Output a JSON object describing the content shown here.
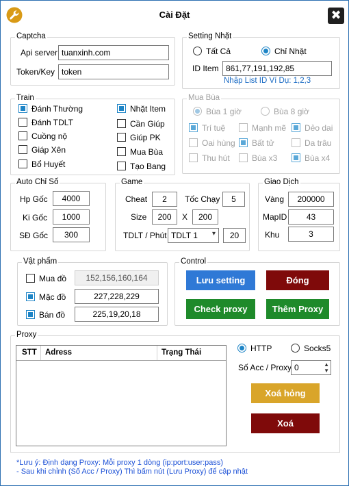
{
  "window": {
    "title": "Cài Đặt",
    "close_glyph": "✖"
  },
  "colors": {
    "accent": "#1d84c6",
    "btn_blue": "#2f79d6",
    "btn_red": "#7f0a0a",
    "btn_green": "#1e8a2a",
    "btn_gold": "#d9a52a",
    "link": "#1a6bc4"
  },
  "captcha": {
    "legend": "Captcha",
    "api_label": "Api server",
    "api_value": "tuanxinh.com",
    "token_label": "Token/Key",
    "token_value": "token"
  },
  "setting_nhat": {
    "legend": "Setting Nhặt",
    "radio_all": "Tất Cả",
    "radio_only": "Chỉ Nhặt",
    "selected": "Chỉ Nhặt",
    "id_label": "ID Item",
    "id_value": "861,77,191,192,85",
    "hint": "Nhập List ID Ví Dụ: 1,2,3"
  },
  "train": {
    "legend": "Train",
    "items": [
      {
        "label": "Đánh Thường",
        "checked": true
      },
      {
        "label": "Đánh TDLT",
        "checked": false
      },
      {
        "label": "Cuồng nộ",
        "checked": false
      },
      {
        "label": "Giáp Xên",
        "checked": false
      },
      {
        "label": "Bổ Huyết",
        "checked": false
      },
      {
        "label": "Nhặt Item",
        "checked": true
      },
      {
        "label": "Cần Giúp",
        "checked": false
      },
      {
        "label": "Giúp PK",
        "checked": false
      },
      {
        "label": "Mua Bùa",
        "checked": false
      },
      {
        "label": "Tạo Bang",
        "checked": false
      }
    ]
  },
  "mua_bua": {
    "legend": "Mua Bùa",
    "radio_1": "Bùa 1 giờ",
    "radio_8": "Bùa 8 giờ",
    "selected": "Bùa 1 giờ",
    "items": [
      {
        "label": "Trí tuệ",
        "checked": true
      },
      {
        "label": "Mạnh mẽ",
        "checked": false
      },
      {
        "label": "Dẻo dai",
        "checked": true
      },
      {
        "label": "Oai hùng",
        "checked": false
      },
      {
        "label": "Bất tử",
        "checked": true
      },
      {
        "label": "Da trâu",
        "checked": false
      },
      {
        "label": "Thu hút",
        "checked": false
      },
      {
        "label": "Bùa x3",
        "checked": false
      },
      {
        "label": "Bùa x4",
        "checked": true
      }
    ]
  },
  "auto_chi_so": {
    "legend": "Auto Chỉ Số",
    "hp_label": "Hp Gốc",
    "hp_value": "4000",
    "ki_label": "Ki Gốc",
    "ki_value": "1000",
    "sd_label": "SĐ Gốc",
    "sd_value": "300"
  },
  "game": {
    "legend": "Game",
    "cheat_label": "Cheat",
    "cheat_value": "2",
    "speed_label": "Tốc Chạy",
    "speed_value": "5",
    "size_label": "Size",
    "size_w": "200",
    "size_x": "X",
    "size_h": "200",
    "tdlt_label": "TDLT / Phút",
    "tdlt_select": "TDLT 1",
    "tdlt_value": "20"
  },
  "giao_dich": {
    "legend": "Giao Dịch",
    "vang_label": "Vàng",
    "vang_value": "200000",
    "map_label": "MapID",
    "map_value": "43",
    "khu_label": "Khu",
    "khu_value": "3"
  },
  "vat_pham": {
    "legend": "Vật phẩm",
    "mua_label": "Mua đồ",
    "mua_checked": false,
    "mua_value": "152,156,160,164",
    "mac_label": "Mặc đồ",
    "mac_checked": true,
    "mac_value": "227,228,229",
    "ban_label": "Bán đồ",
    "ban_checked": true,
    "ban_value": "225,19,20,18"
  },
  "control": {
    "legend": "Control",
    "save": "Lưu setting",
    "close": "Đóng",
    "check_proxy": "Check proxy",
    "add_proxy": "Thêm Proxy"
  },
  "proxy": {
    "legend": "Proxy",
    "columns": [
      "STT",
      "Adress",
      "Trạng Thái"
    ],
    "rows": [],
    "radio_http": "HTTP",
    "radio_socks": "Socks5",
    "selected": "HTTP",
    "acc_label": "Số Acc / Proxy",
    "acc_value": "0",
    "btn_remove_bad": "Xoá hỏng",
    "btn_remove": "Xoá"
  },
  "notes": {
    "line1": "*Lưu ý:  Định dạng Proxy: Mỗi proxy 1 dòng (ip:port:user:pass)",
    "line2": "- Sau khi chỉnh (Số Acc / Proxy) Thì bấm nút (Lưu Proxy) để cập nhật"
  }
}
